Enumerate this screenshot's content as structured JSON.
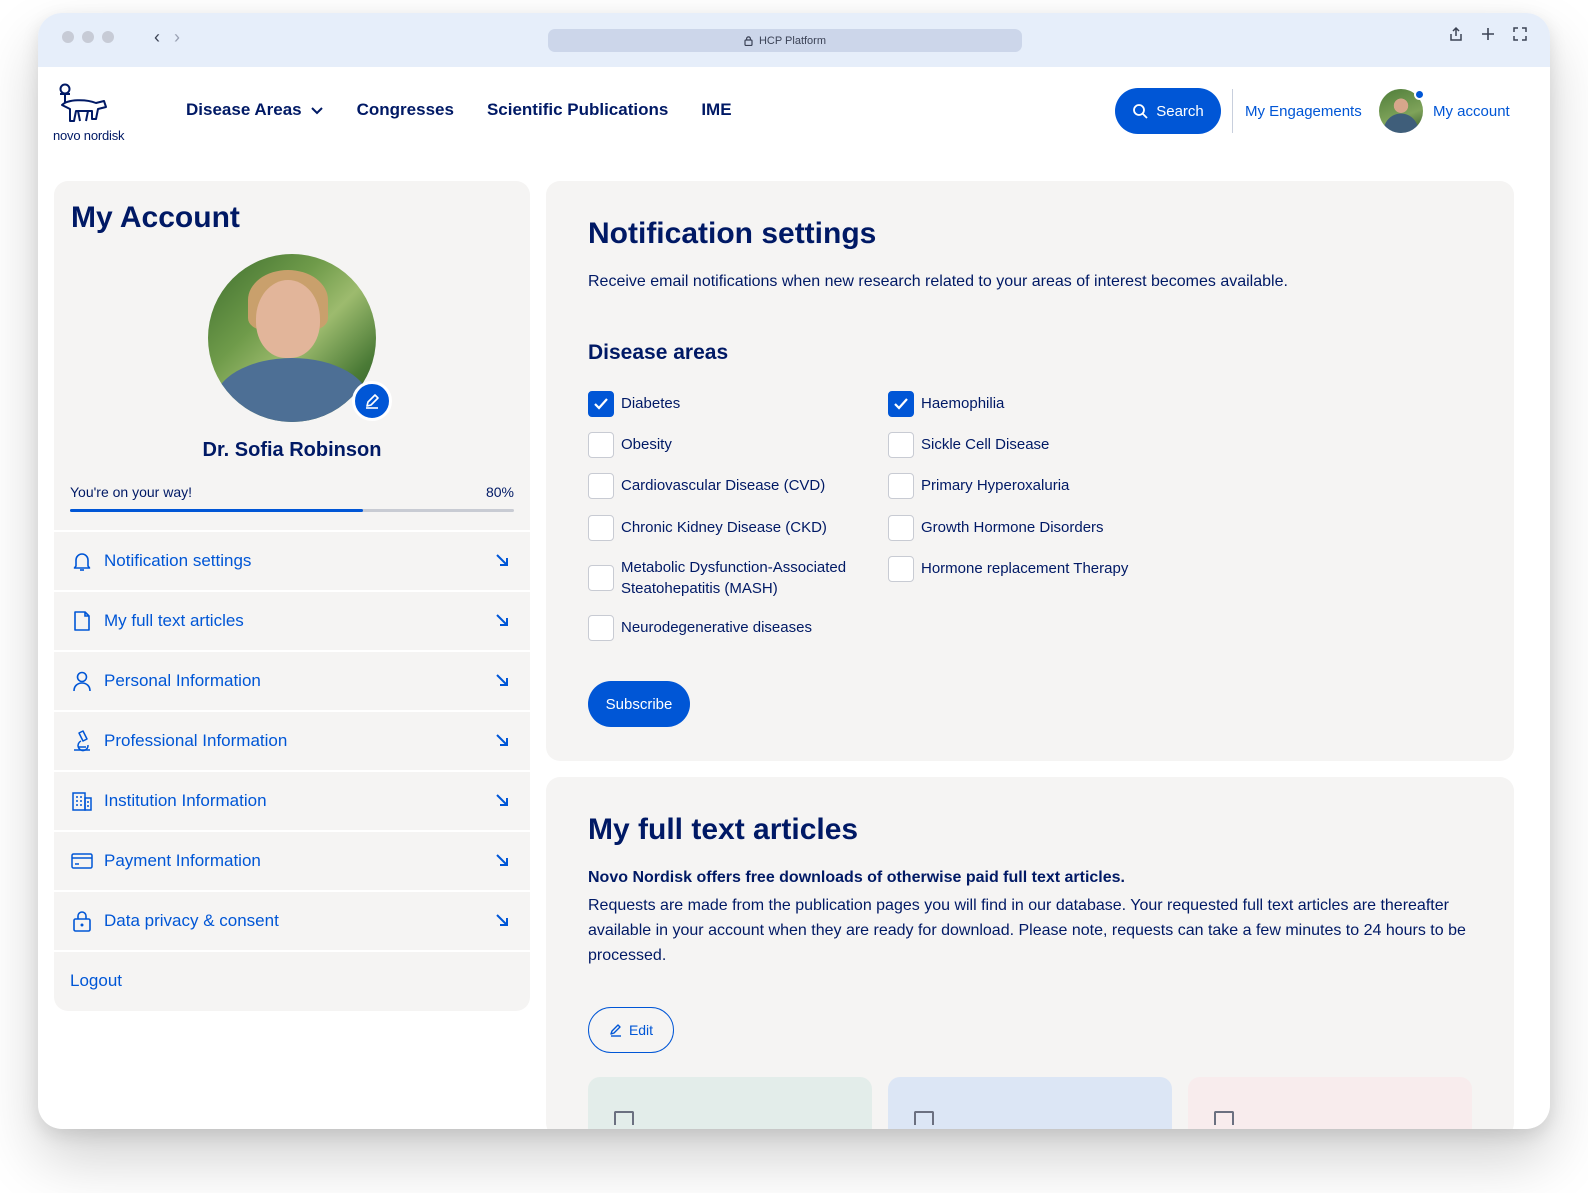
{
  "browser": {
    "url_label": "HCP Platform"
  },
  "header": {
    "logo_text": "novo nordisk",
    "nav": [
      {
        "label": "Disease Areas",
        "has_dropdown": true
      },
      {
        "label": "Congresses"
      },
      {
        "label": "Scientific Publications"
      },
      {
        "label": "IME"
      }
    ],
    "search_label": "Search",
    "engagements_label": "My Engagements",
    "account_label": "My account"
  },
  "sidebar": {
    "title": "My Account",
    "name": "Dr. Sofia Robinson",
    "progress_label": "You're on your way!",
    "progress_text": "80%",
    "progress_value": 0.66,
    "menu": [
      {
        "label": "Notification settings",
        "icon": "bell-icon"
      },
      {
        "label": "My full text articles",
        "icon": "document-icon"
      },
      {
        "label": "Personal Information",
        "icon": "person-icon"
      },
      {
        "label": "Professional Information",
        "icon": "microscope-icon"
      },
      {
        "label": "Institution Information",
        "icon": "building-icon"
      },
      {
        "label": "Payment Information",
        "icon": "credit-card-icon"
      },
      {
        "label": "Data privacy & consent",
        "icon": "lock-icon"
      }
    ],
    "logout": "Logout"
  },
  "notifications": {
    "title": "Notification settings",
    "description": "Receive email notifications when new research related to your areas of interest becomes available.",
    "subtitle": "Disease areas",
    "left_column": [
      {
        "label": "Diabetes",
        "checked": true
      },
      {
        "label": "Obesity",
        "checked": false
      },
      {
        "label": "Cardiovascular Disease (CVD)",
        "checked": false
      },
      {
        "label": "Chronic Kidney Disease (CKD)",
        "checked": false
      },
      {
        "label": "Metabolic Dysfunction-Associated Steatohepatitis (MASH)",
        "checked": false
      },
      {
        "label": "Neurodegenerative diseases",
        "checked": false
      }
    ],
    "right_column": [
      {
        "label": "Haemophilia",
        "checked": true
      },
      {
        "label": "Sickle Cell Disease",
        "checked": false
      },
      {
        "label": "Primary Hyperoxaluria",
        "checked": false
      },
      {
        "label": "Growth Hormone Disorders",
        "checked": false
      },
      {
        "label": "Hormone replacement Therapy",
        "checked": false
      }
    ],
    "subscribe_label": "Subscribe"
  },
  "articles": {
    "title": "My full text articles",
    "lead": "Novo Nordisk offers free downloads of otherwise paid full text articles.",
    "body": "Requests are made from the publication pages you will find in our database. Your requested full text articles  are thereafter available in your account when they are ready for download. Please note, requests can take a few minutes to 24 hours to be processed.",
    "edit_label": "Edit",
    "card_colors": [
      "#e3edea",
      "#dce6f5",
      "#f8eced"
    ]
  },
  "colors": {
    "brand_blue": "#0056d6",
    "navy": "#001965",
    "panel_bg": "#f5f4f3"
  }
}
